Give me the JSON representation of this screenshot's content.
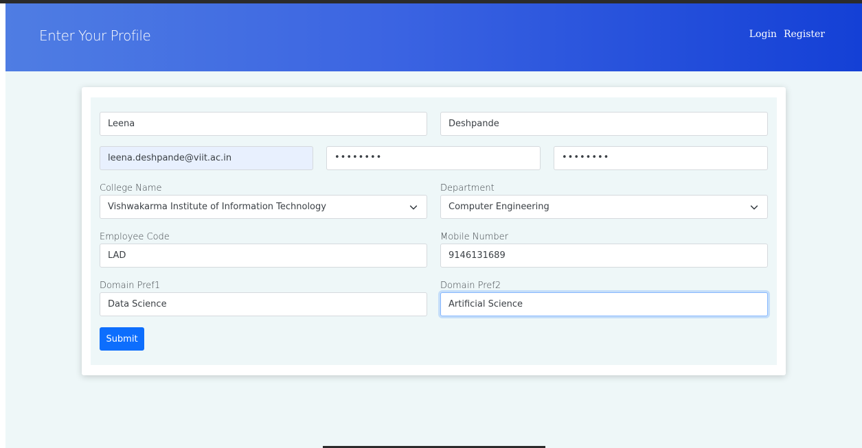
{
  "header": {
    "title": "Enter Your Profile",
    "nav": [
      {
        "label": "Login"
      },
      {
        "label": "Register"
      }
    ]
  },
  "form": {
    "first_name": {
      "value": "Leena"
    },
    "last_name": {
      "value": "Deshpande"
    },
    "email": {
      "value": "leena.deshpande@viit.ac.in"
    },
    "password": {
      "value": "••••••••"
    },
    "confirm_password": {
      "value": "••••••••"
    },
    "college": {
      "label": "College Name",
      "value": "Vishwakarma Institute of Information Technology"
    },
    "department": {
      "label": "Department",
      "value": "Computer Engineering"
    },
    "employee_code": {
      "label": "Employee Code",
      "value": "LAD"
    },
    "mobile": {
      "label": "Mobile Number",
      "value": "9146131689"
    },
    "domain_pref1": {
      "label": "Domain Pref1",
      "value": "Data Science"
    },
    "domain_pref2": {
      "label": "Domain Pref2",
      "value": "Artificial Science"
    },
    "submit_label": "Submit"
  },
  "icons": {
    "select_arrow": "chevron-down-icon"
  },
  "colors": {
    "header_start": "#4f7de3",
    "header_end": "#1440d6",
    "page_bg": "#eef7f8",
    "primary": "#0d6efd",
    "autofill": "#e8f0fe"
  }
}
